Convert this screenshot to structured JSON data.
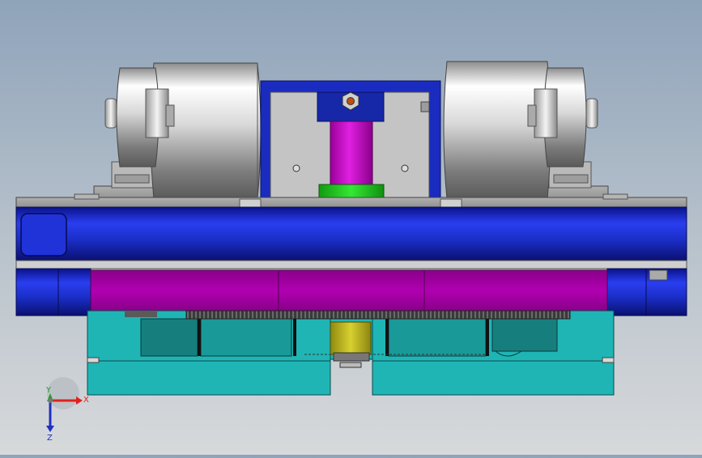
{
  "triad": {
    "x_label": "X",
    "y_label": "Y",
    "z_label": "Z",
    "x_color": "#e02020",
    "y_color": "#20a020",
    "z_color": "#2030c0"
  },
  "palette": {
    "background_top": "#8fa3ba",
    "background_bottom": "#d7d9db",
    "frame_blue": "#1b2fc9",
    "carriage_magenta": "#b000b0",
    "base_teal": "#1fb5b5",
    "spacer_green": "#22c822",
    "gear_yellow": "#c8c020",
    "roller_silver": "#c0c0c0"
  }
}
